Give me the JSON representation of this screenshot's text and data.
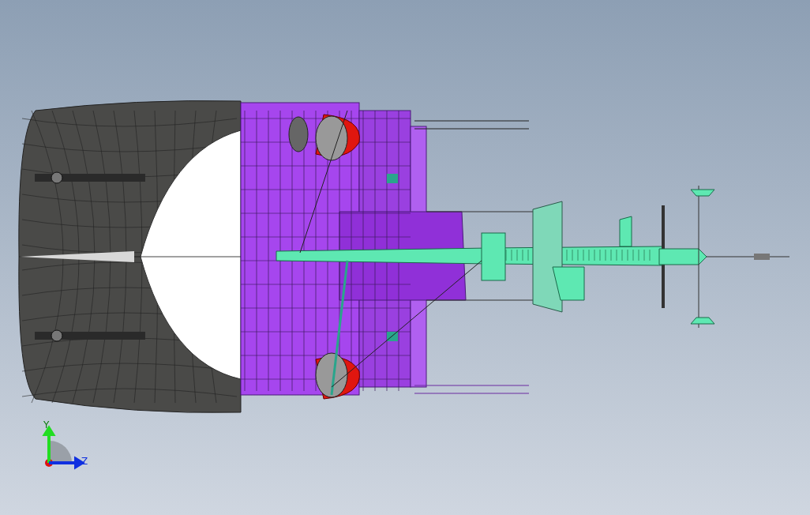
{
  "viewport": {
    "axes": [
      {
        "kind": "y",
        "label": "Y"
      },
      {
        "kind": "z",
        "label": "Z"
      }
    ]
  }
}
